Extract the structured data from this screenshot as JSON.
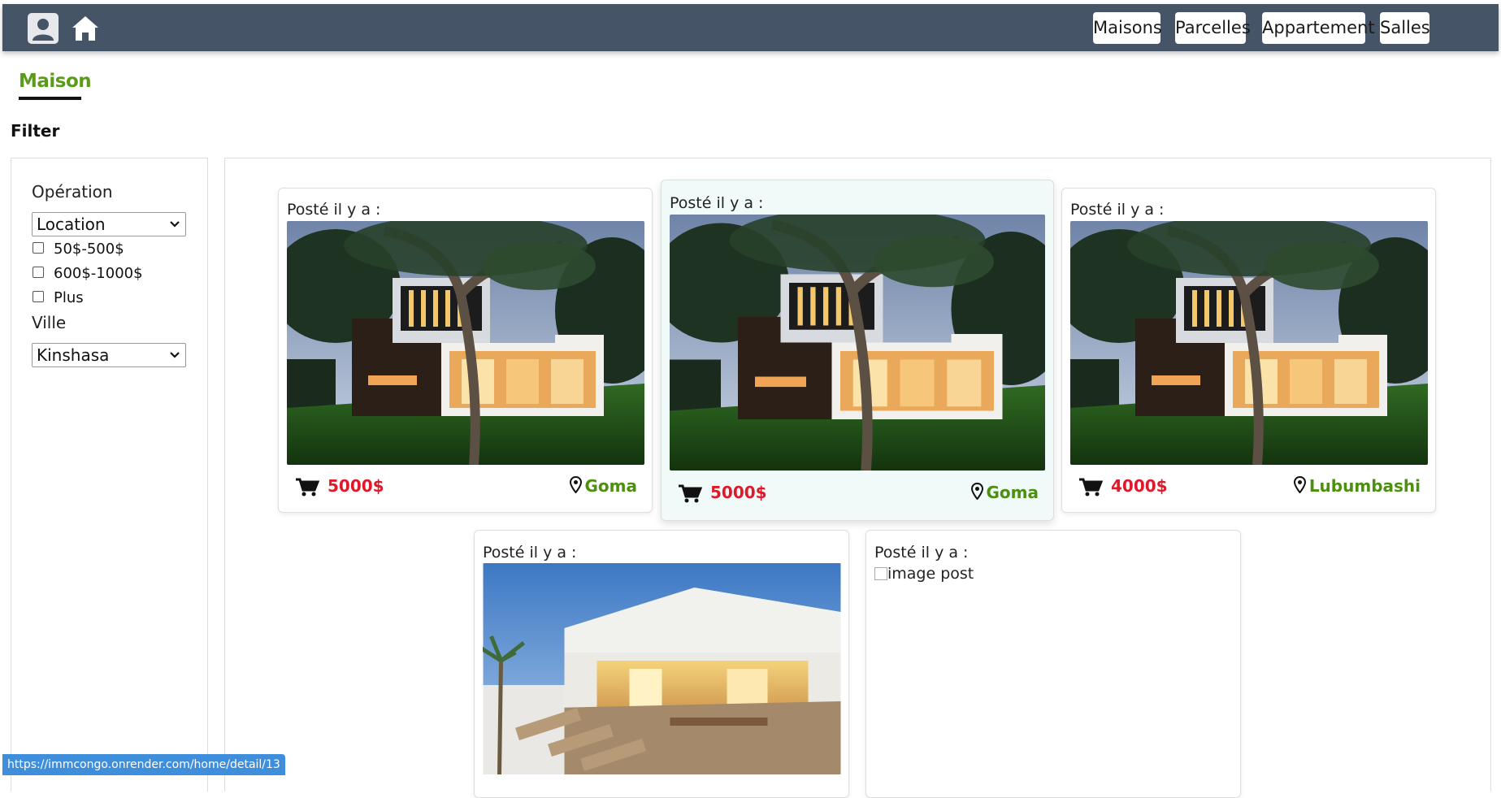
{
  "navbar": {
    "bg_color": "#465467",
    "user_icon": "user-icon",
    "home_icon": "home-icon",
    "buttons": [
      "Maisons",
      "Parcelles",
      "Appartement",
      "Salles"
    ]
  },
  "page": {
    "title": "Maison",
    "title_color": "#5c9b1a",
    "filter_label": "Filter"
  },
  "sidebar": {
    "operation_label": "Opération",
    "operation_value": "Location",
    "price_ranges": [
      "50$-500$",
      "600$-1000$",
      "Plus"
    ],
    "ville_label": "Ville",
    "ville_value": "Kinshasa"
  },
  "listings": [
    {
      "posted": "Posté il y a :",
      "price": "5000$",
      "city": "Goma",
      "image": "modern-house-night"
    },
    {
      "posted": "Posté il y a :",
      "price": "5000$",
      "city": "Goma",
      "image": "modern-house-night"
    },
    {
      "posted": "Posté il y a :",
      "price": "4000$",
      "city": "Lubumbashi",
      "image": "modern-house-night"
    },
    {
      "posted": "Posté il y a :",
      "image": "white-house-patio"
    },
    {
      "posted": "Posté il y a :",
      "image_alt": "image post"
    }
  ],
  "colors": {
    "price": "#e0192a",
    "city": "#4d8f0f",
    "hover_card": "#f0fbf9",
    "status_bar": "#3f8edb"
  },
  "status_url": "https://immcongo.onrender.com/home/detail/13"
}
